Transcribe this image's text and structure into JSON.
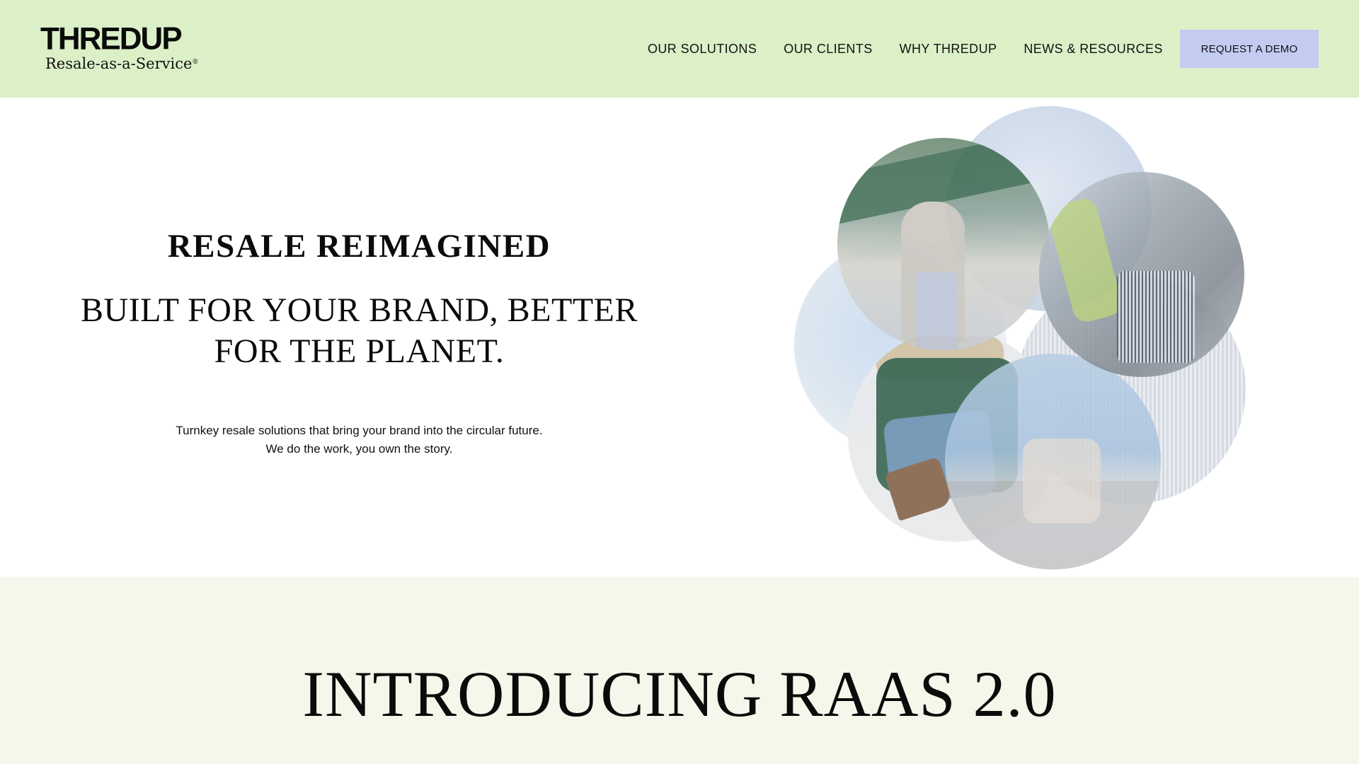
{
  "brand": {
    "name": "THREDUP",
    "tagline": "Resale-as-a-Service",
    "trademark": "®"
  },
  "nav": {
    "items": [
      {
        "label": "OUR SOLUTIONS"
      },
      {
        "label": "OUR CLIENTS"
      },
      {
        "label": "WHY THREDUP"
      },
      {
        "label": "NEWS & RESOURCES"
      }
    ],
    "cta_label": "REQUEST A DEMO"
  },
  "hero": {
    "kicker": "RESALE REIMAGINED",
    "headline_line1": "BUILT FOR YOUR BRAND, BETTER",
    "headline_line2": "FOR THE PLANET.",
    "subcopy_line1": "Turnkey resale solutions that bring your brand into the circular future.",
    "subcopy_line2": "We do the work, you own the story."
  },
  "band": {
    "title": "INTRODUCING RAAS 2.0"
  },
  "colors": {
    "header_bg": "#dcf0c8",
    "cta_bg": "#c4cbf1",
    "band_bg": "#f4f8ea",
    "text": "#0b0b0b"
  }
}
